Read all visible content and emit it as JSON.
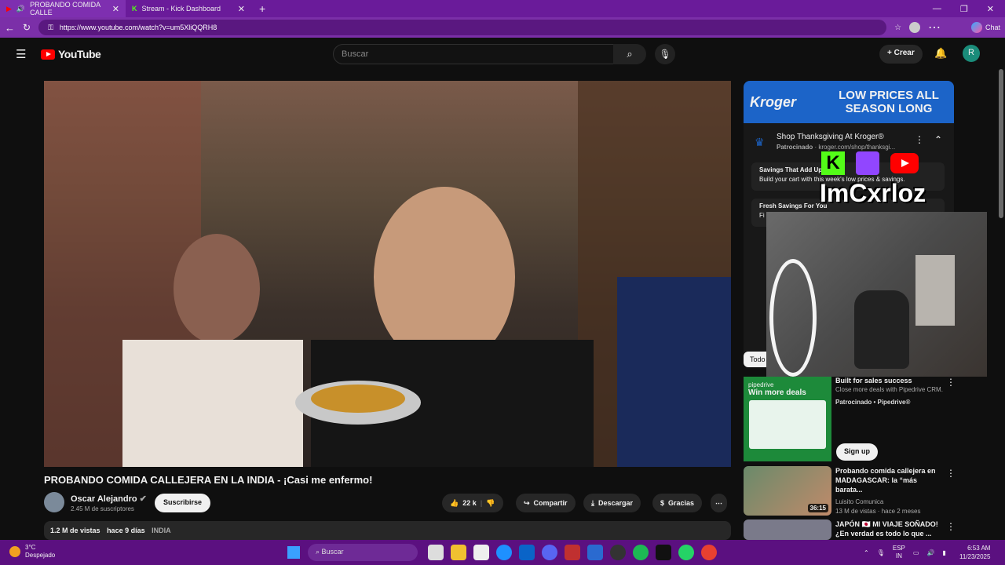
{
  "browser": {
    "tabs": [
      {
        "label": "PROBANDO COMIDA CALLE"
      },
      {
        "label": "Stream - Kick Dashboard"
      }
    ],
    "url": "https://www.youtube.com/watch?v=um5XliQQRH8",
    "chat_label": "Chat"
  },
  "youtube": {
    "logo": "YouTube",
    "search_placeholder": "Buscar",
    "create_label": "Crear",
    "avatar_letter": "R"
  },
  "video": {
    "title": "PROBANDO COMIDA CALLEJERA EN LA INDIA - ¡Casi me enfermo!",
    "channel": "Oscar Alejandro",
    "subscribers": "2.45 M de suscriptores",
    "subscribe_label": "Suscribirse",
    "likes": "22 k",
    "share_label": "Compartir",
    "download_label": "Descargar",
    "thanks_label": "Gracias",
    "views": "1.2 M de vistas",
    "age": "hace 9 días",
    "tag": "INDIA"
  },
  "ad": {
    "brand": "Kroger",
    "banner_text": "LOW PRICES ALL SEASON LONG",
    "title": "Shop Thanksgiving At Kroger®",
    "sponsored": "Patrocinado",
    "domain": "kroger.com/shop/thanksgi...",
    "rows": [
      {
        "title": "Savings That Add Up",
        "text": "Build your cart with this week's low prices & savings."
      },
      {
        "title": "Fresh Savings For You",
        "text": "Fi"
      }
    ],
    "chip": "Todo"
  },
  "overlay": {
    "handle": "ImCxrloz"
  },
  "recommendations": [
    {
      "title": "Built for sales success",
      "meta1": "Close more deals with Pipedrive CRM.",
      "meta2": "Patrocinado • Pipedrive®",
      "thumb_brand": "pipedrive",
      "thumb_text": "Win more deals",
      "button": "Sign up"
    },
    {
      "title": "Probando comida callejera en MADAGASCAR: la “más barata...",
      "meta1": "Luisito Comunica",
      "meta2": "13 M de vistas · hace 2 meses",
      "duration": "36:15"
    },
    {
      "title": "JAPÓN 🇯🇵 MI VIAJE SOÑADO! ¿En verdad es todo lo que ...",
      "meta1": "",
      "meta2": ""
    }
  ],
  "taskbar": {
    "temp": "3°C",
    "weather": "Despejado",
    "search": "Buscar",
    "lang1": "ESP",
    "lang2": "IN",
    "time": "6:53 AM",
    "date": "11/23/2025"
  }
}
